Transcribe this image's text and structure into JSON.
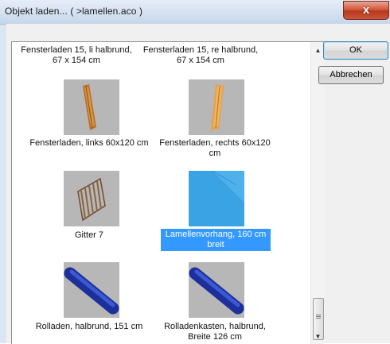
{
  "window": {
    "title": "Objekt laden...  ( >lamellen.aco )",
    "close_symbol": "x"
  },
  "buttons": {
    "ok": "OK",
    "cancel": "Abbrechen"
  },
  "items": [
    {
      "label": "Fensterladen 15, li halbrund, 67 x 154 cm",
      "icon": "shutter-round-left-icon"
    },
    {
      "label": "Fensterladen 15, re halbrund, 67 x 154 cm",
      "icon": "shutter-round-right-icon"
    },
    {
      "label": "Fensterladen, links 60x120 cm",
      "icon": "shutter-left-icon"
    },
    {
      "label": "Fensterladen, rechts 60x120 cm",
      "icon": "shutter-right-icon"
    },
    {
      "label": "Gitter 7",
      "icon": "grille-icon"
    },
    {
      "label": "Lamellenvorhang, 160 cm breit",
      "icon": "slat-curtain-icon",
      "selected": true
    },
    {
      "label": "Rolladen, halbrund, 151 cm",
      "icon": "roller-shutter-icon"
    },
    {
      "label": "Rolladenkasten, halbrund, Breite 126 cm",
      "icon": "roller-box-icon"
    }
  ],
  "colors": {
    "selection": "#3399ff",
    "thumb_bg": "#b7b7b7",
    "wood": "#d89a43",
    "roll_blue": "#2440b8",
    "curtain_blue": "#3aa3e3"
  }
}
